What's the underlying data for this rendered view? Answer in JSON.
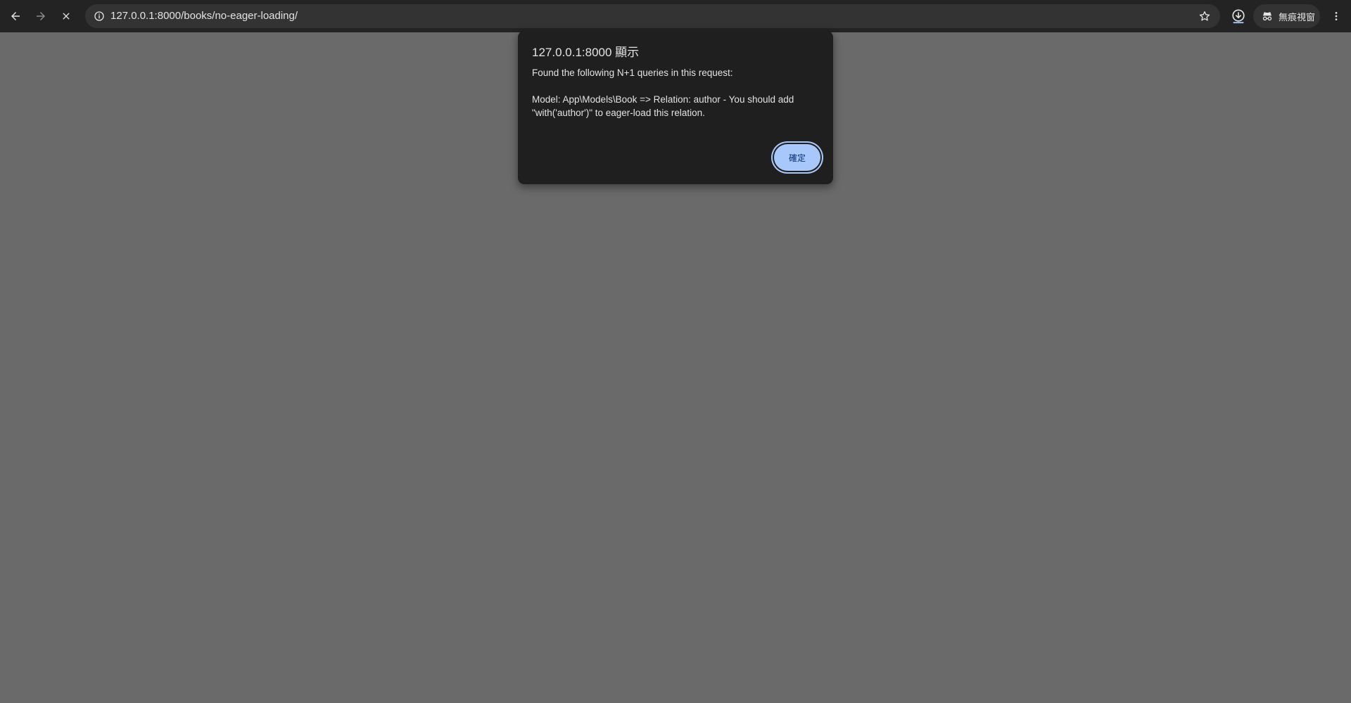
{
  "browser": {
    "url": "127.0.0.1:8000/books/no-eager-loading/",
    "incognito_label": "無痕視窗",
    "icons": {
      "back": "arrow-left-icon",
      "forward": "arrow-right-icon",
      "stop": "close-icon",
      "site_info": "info-icon",
      "bookmark": "star-icon",
      "download": "download-icon",
      "incognito": "incognito-icon",
      "menu": "vertical-dots-icon"
    }
  },
  "dialog": {
    "title": "127.0.0.1:8000 顯示",
    "message": "Found the following N+1 queries in this request:\n\nModel: App\\Models\\Book => Relation: author - You should add \"with('author')\" to eager-load this relation.",
    "ok_label": "確定"
  },
  "colors": {
    "page_background": "#6a6a6a",
    "toolbar_background": "#232323",
    "dialog_background": "#1f1f1f",
    "accent": "#a8c7fa"
  }
}
